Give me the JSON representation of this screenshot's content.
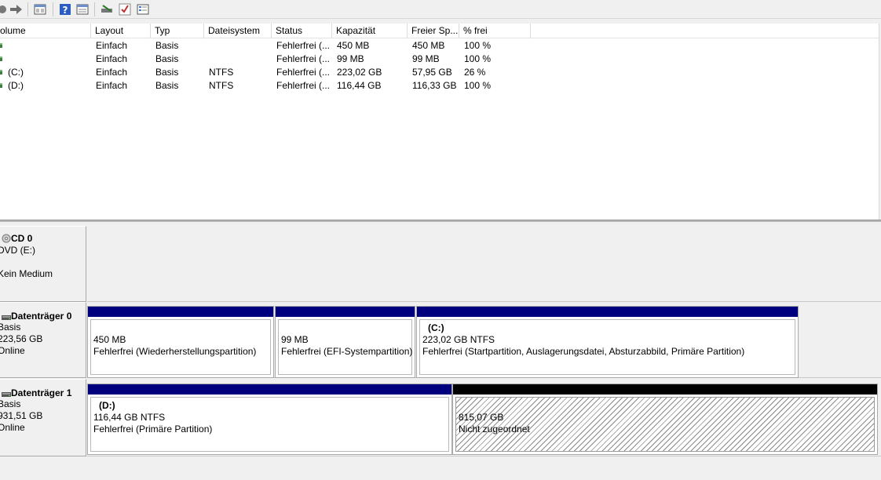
{
  "toolbar": {
    "icons": [
      "forward-arrow-icon",
      "properties-icon",
      "help-icon",
      "view-icon",
      "rescan-icon",
      "check-icon",
      "list-icon"
    ]
  },
  "list": {
    "columns": [
      "olume",
      "Layout",
      "Typ",
      "Dateisystem",
      "Status",
      "Kapazität",
      "Freier Sp...",
      "% frei"
    ],
    "rows": [
      {
        "volume": "",
        "layout": "Einfach",
        "typ": "Basis",
        "fs": "",
        "status": "Fehlerfrei (...",
        "kap": "450 MB",
        "frei": "450 MB",
        "pct": "100 %"
      },
      {
        "volume": "",
        "layout": "Einfach",
        "typ": "Basis",
        "fs": "",
        "status": "Fehlerfrei (...",
        "kap": "99 MB",
        "frei": "99 MB",
        "pct": "100 %"
      },
      {
        "volume": "(C:)",
        "layout": "Einfach",
        "typ": "Basis",
        "fs": "NTFS",
        "status": "Fehlerfrei (...",
        "kap": "223,02 GB",
        "frei": "57,95 GB",
        "pct": "26 %"
      },
      {
        "volume": "(D:)",
        "layout": "Einfach",
        "typ": "Basis",
        "fs": "NTFS",
        "status": "Fehlerfrei (...",
        "kap": "116,44 GB",
        "frei": "116,33 GB",
        "pct": "100 %"
      }
    ]
  },
  "disks": {
    "cd0": {
      "name": "CD 0",
      "line1": "DVD (E:)",
      "line2": "Kein Medium"
    },
    "disk0": {
      "name": "Datenträger 0",
      "line1": "Basis",
      "line2": "223,56 GB",
      "line3": "Online",
      "parts": [
        {
          "title": "",
          "size": "450 MB",
          "status": "Fehlerfrei (Wiederherstellungspartition)"
        },
        {
          "title": "",
          "size": "99 MB",
          "status": "Fehlerfrei (EFI-Systempartition)"
        },
        {
          "title": "(C:)",
          "size": "223,02 GB NTFS",
          "status": "Fehlerfrei (Startpartition, Auslagerungsdatei, Absturzabbild, Primäre Partition)"
        }
      ]
    },
    "disk1": {
      "name": "Datenträger 1",
      "line1": "Basis",
      "line2": "931,51 GB",
      "line3": "Online",
      "parts": [
        {
          "title": "(D:)",
          "size": "116,44 GB NTFS",
          "status": "Fehlerfrei (Primäre Partition)"
        },
        {
          "title": "",
          "size": "815,07 GB",
          "status": "Nicht zugeordnet"
        }
      ]
    }
  },
  "colors": {
    "primary_partition": "#00007f",
    "unallocated": "#000000"
  }
}
